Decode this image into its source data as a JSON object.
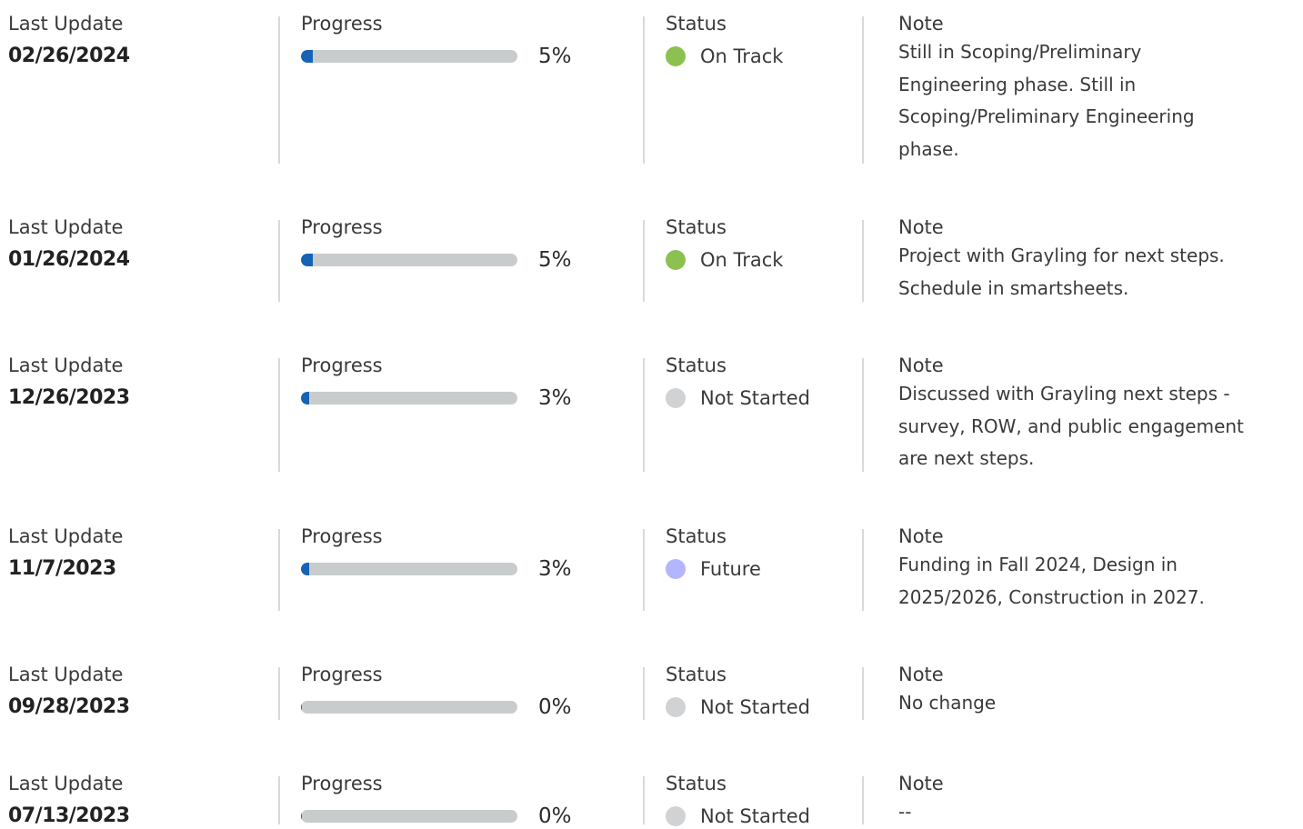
{
  "column_labels": {
    "last_update": "Last Update",
    "progress": "Progress",
    "status": "Status",
    "note": "Note"
  },
  "status_colors": {
    "On Track": "#8cc152",
    "Not Started": "#d0d2d3",
    "Future": "#b3b5ff"
  },
  "bar_colors": {
    "fill": "#1463b6",
    "track": "#c9cccd"
  },
  "updates": [
    {
      "date": "02/26/2024",
      "progress_percent": 5,
      "progress_label": "5%",
      "status": "On Track",
      "note_lines": [
        "Still in Scoping/Preliminary",
        "Engineering phase. Still in",
        "Scoping/Preliminary Engineering",
        "phase."
      ]
    },
    {
      "date": "01/26/2024",
      "progress_percent": 5,
      "progress_label": "5%",
      "status": "On Track",
      "note_lines": [
        "Project with Grayling for next steps.",
        "Schedule in smartsheets."
      ]
    },
    {
      "date": "12/26/2023",
      "progress_percent": 3,
      "progress_label": "3%",
      "status": "Not Started",
      "note_lines": [
        "Discussed with Grayling next steps -",
        "survey, ROW, and public engagement",
        "are next steps."
      ]
    },
    {
      "date": "11/7/2023",
      "progress_percent": 3,
      "progress_label": "3%",
      "status": "Future",
      "note_lines": [
        "Funding in Fall 2024, Design in",
        "2025/2026, Construction in 2027."
      ]
    },
    {
      "date": "09/28/2023",
      "progress_percent": 0,
      "progress_label": "0%",
      "status": "Not Started",
      "note_lines": [
        "No change"
      ]
    },
    {
      "date": "07/13/2023",
      "progress_percent": 0,
      "progress_label": "0%",
      "status": "Not Started",
      "note_lines": [
        "--"
      ]
    }
  ]
}
